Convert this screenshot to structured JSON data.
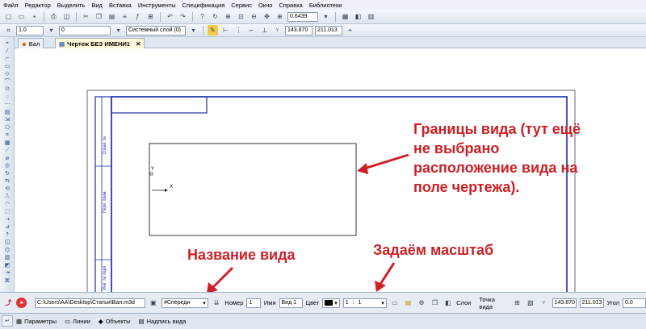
{
  "menu": [
    "Файл",
    "Редактор",
    "Выделить",
    "Вид",
    "Вставка",
    "Инструменты",
    "Спецификация",
    "Сервис",
    "Окно",
    "Справка",
    "Библиотеки"
  ],
  "toolbar1": {
    "zoom_value": "0.6439"
  },
  "toolbar2": {
    "step_value": "1.0",
    "layer_value": "0",
    "layer_name": "Системный слой (0)",
    "coord_x": "143.870",
    "coord_y": "211.013"
  },
  "tabs": [
    {
      "label": "Вал",
      "active": false
    },
    {
      "label": "Чертеж БЕЗ ИМЕНИ1",
      "active": true
    }
  ],
  "drawing": {
    "axis_y": "Y",
    "axis_x": "X",
    "stamp_texts": [
      "Справ. №",
      "Перв. прим.",
      "Инв. № подл."
    ]
  },
  "annotations": {
    "view_bounds": [
      "Границы вида (тут ещё",
      "не выбрано",
      "расположение вида на",
      "поле чертежа)."
    ],
    "view_name": "Название вида",
    "scale": "Задаём масштаб"
  },
  "params": {
    "path": "C:\\Users\\AA\\Desktop\\Статьи\\Вал.m3d",
    "view_select": "#Спереди",
    "number_label": "Номер",
    "number_value": "1",
    "name_label": "Имя",
    "name_value": "Вид 1",
    "color_label": "Цвет",
    "scale_left": "1",
    "scale_sep": ":",
    "scale_right": "1",
    "layers_label": "Слои",
    "viewpoint_label": "Точка вида",
    "vx": "143.870",
    "vy": "211.013",
    "angle_label": "Угол",
    "angle_value": "0.0"
  },
  "bottom_tabs": [
    "Параметры",
    "Линии",
    "Объекты",
    "Надпись вида"
  ],
  "colors": {
    "annotation": "#cc1f26",
    "frame": "#1c2fa8"
  }
}
